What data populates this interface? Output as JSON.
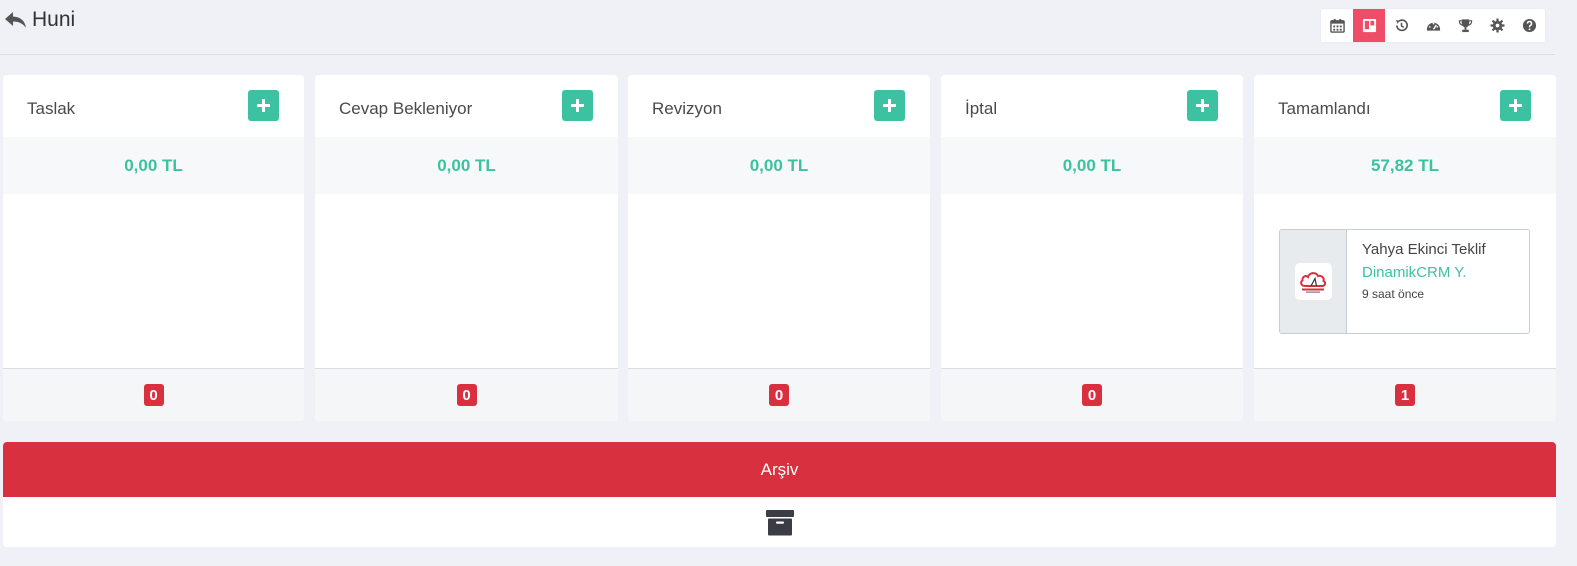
{
  "header": {
    "title": "Huni",
    "toolbar_icons": [
      "calendar-icon",
      "kanban-icon",
      "history-icon",
      "dashboard-icon",
      "trophy-icon",
      "gear-icon",
      "help-icon"
    ],
    "active_icon": "kanban-icon"
  },
  "columns": [
    {
      "title": "Taslak",
      "total": "0,00 TL",
      "count": "0"
    },
    {
      "title": "Cevap Bekleniyor",
      "total": "0,00 TL",
      "count": "0"
    },
    {
      "title": "Revizyon",
      "total": "0,00 TL",
      "count": "0"
    },
    {
      "title": "İptal",
      "total": "0,00 TL",
      "count": "0"
    },
    {
      "title": "Tamamlandı",
      "total": "57,82 TL",
      "count": "1",
      "cards": [
        {
          "title": "Yahya Ekinci Teklif",
          "company": "DinamikCRM Y.",
          "time": "9 saat önce",
          "logo": "cloud-logo-icon"
        }
      ]
    }
  ],
  "archive": {
    "label": "Arşiv",
    "icon": "archive-box-icon"
  },
  "colors": {
    "accent_green": "#3cc2a1",
    "accent_red": "#d9303f",
    "active_pink": "#ef4d67"
  }
}
